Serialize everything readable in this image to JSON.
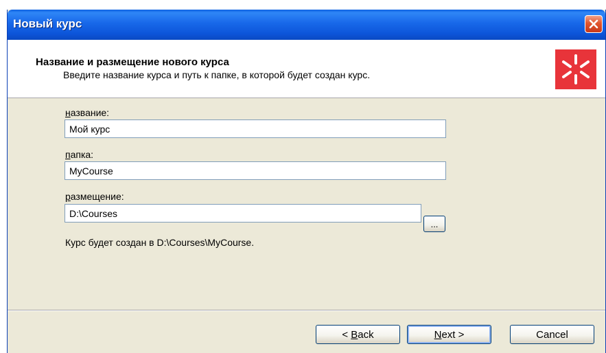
{
  "window": {
    "title": "Новый курс"
  },
  "header": {
    "title": "Название и размещение нового курса",
    "subtitle": "Введите название курса и путь к папке, в которой будет создан курс.",
    "logo_icon": "asterisk-logo-icon",
    "logo_color": "#e8343a"
  },
  "form": {
    "name_label_key": "н",
    "name_label_rest": "азвание:",
    "name_value": "Мой курс",
    "folder_label_key": "п",
    "folder_label_rest": "апка:",
    "folder_value": "MyCourse",
    "location_label_key": "р",
    "location_label_rest": "азмещение:",
    "location_value": "D:\\Courses",
    "browse_label": "...",
    "info": "Курс будет создан в D:\\Courses\\MyCourse."
  },
  "buttons": {
    "back_prefix": "< ",
    "back_key": "B",
    "back_rest": "ack",
    "next_key": "N",
    "next_rest": "ext >",
    "cancel": "Cancel"
  },
  "colors": {
    "titlebar": "#1868e9",
    "close": "#e1552e",
    "dialog_bg": "#ece9d8"
  }
}
